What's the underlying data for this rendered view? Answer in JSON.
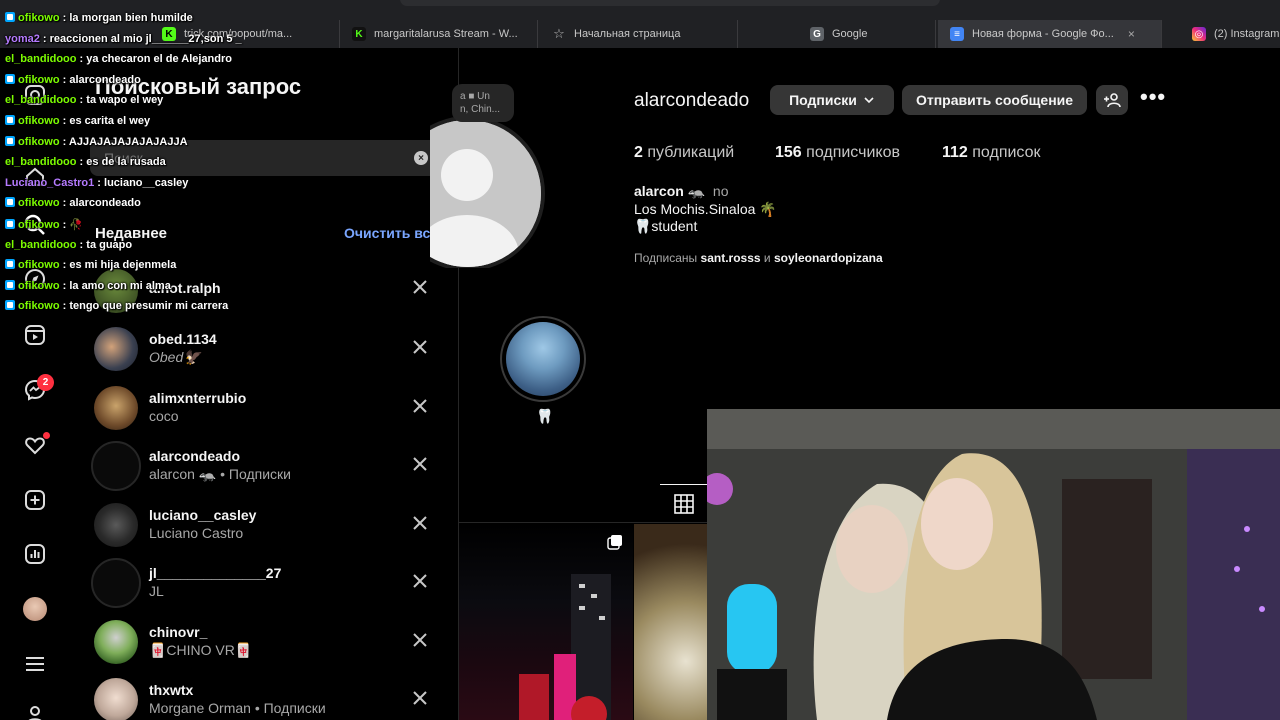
{
  "browser": {
    "tabs": [
      {
        "title": "",
        "fav": "green-k",
        "partial": "trick.com/popout/ma..."
      },
      {
        "title": "margaritalarusa Stream - W...",
        "fav": "kick-icon"
      },
      {
        "title": "Начальная страница",
        "fav": "star-icon"
      },
      {
        "title": "Google",
        "fav": "google-icon"
      },
      {
        "title": "Новая форма - Google Фо...",
        "fav": "forms-icon"
      },
      {
        "title": "(2) Instagram",
        "fav": "instagram-icon"
      }
    ],
    "close_glyph": "×"
  },
  "search_panel": {
    "title": "Поисковый запрос",
    "search_placeholder": "Поиск",
    "clear_glyph": "×",
    "recent_label": "Недавнее",
    "clear_all_label": "Очистить все",
    "items": [
      {
        "username": "a.not.ralph",
        "subtitle": ""
      },
      {
        "username": "obed.1134",
        "subtitle": "Obed🦅"
      },
      {
        "username": "alimxnterrubio",
        "subtitle": "coco"
      },
      {
        "username": "alarcondeado",
        "subtitle": "alarcon 🦡 • Подписки"
      },
      {
        "username": "luciano__casley",
        "subtitle": "Luciano Castro"
      },
      {
        "username": "jl______________27",
        "subtitle": "JL"
      },
      {
        "username": "chinovr_",
        "subtitle": "🀄CHINO VR🀄"
      },
      {
        "username": "thxwtx",
        "subtitle": "Morgane Orman • Подписки"
      }
    ]
  },
  "nav": {
    "messages_badge": "2"
  },
  "profile": {
    "username": "alarcondeado",
    "following_button": "Подписки",
    "message_button": "Отправить сообщение",
    "more_glyph": "•••",
    "note_lines": [
      "a ■ Un",
      "n, Chin..."
    ],
    "stats": {
      "posts_count": "2",
      "posts_label": "публикаций",
      "followers_count": "156",
      "followers_label": "подписчиков",
      "following_count": "112",
      "following_label": "подписок"
    },
    "bio": {
      "name": "alarcon 🦡",
      "pronouns": "no",
      "line2": "Los Mochis.Sinaloa 🌴",
      "line3": "🦷student"
    },
    "followed_by": {
      "prefix": "Подписаны",
      "user1": "sant.rosss",
      "joiner": "и",
      "user2": "soyleonardopizana"
    },
    "highlight_label": "🦷"
  },
  "chat": [
    {
      "user": "ofikowo",
      "color": "#7cfc00",
      "msg": ": la morgan bien humilde",
      "badge": true
    },
    {
      "user": "yoma2",
      "color": "#b57bff",
      "msg": ": reaccionen al mio jl______27,son 5 _",
      "badge": false
    },
    {
      "user": "el_bandidooo",
      "color": "#7cfc00",
      "msg": ": ya checaron el de Alejandro",
      "badge": false
    },
    {
      "user": "ofikowo",
      "color": "#7cfc00",
      "msg": ": alarcondeado",
      "badge": true
    },
    {
      "user": "el_bandidooo",
      "color": "#7cfc00",
      "msg": ": ta wapo el wey",
      "badge": false
    },
    {
      "user": "ofikowo",
      "color": "#7cfc00",
      "msg": ": es carita el wey",
      "badge": true
    },
    {
      "user": "ofikowo",
      "color": "#7cfc00",
      "msg": ": AJJAJAJAJAJAJAJJA",
      "badge": true
    },
    {
      "user": "el_bandidooo",
      "color": "#7cfc00",
      "msg": ": es de la rusada",
      "badge": false
    },
    {
      "user": "Luciano_Castro1",
      "color": "#b57bff",
      "msg": ": luciano__casley",
      "badge": false
    },
    {
      "user": "ofikowo",
      "color": "#7cfc00",
      "msg": ": alarcondeado",
      "badge": true
    },
    {
      "user": "ofikowo",
      "color": "#7cfc00",
      "msg": ": 🥀",
      "badge": true
    },
    {
      "user": "el_bandidooo",
      "color": "#7cfc00",
      "msg": ": ta guapo",
      "badge": false
    },
    {
      "user": "ofikowo",
      "color": "#7cfc00",
      "msg": ": es mi hija dejenmela",
      "badge": true
    },
    {
      "user": "ofikowo",
      "color": "#7cfc00",
      "msg": ": la amo con mi alma",
      "badge": true
    },
    {
      "user": "ofikowo",
      "color": "#7cfc00",
      "msg": ": tengo que presumir mi carrera",
      "badge": true
    }
  ]
}
